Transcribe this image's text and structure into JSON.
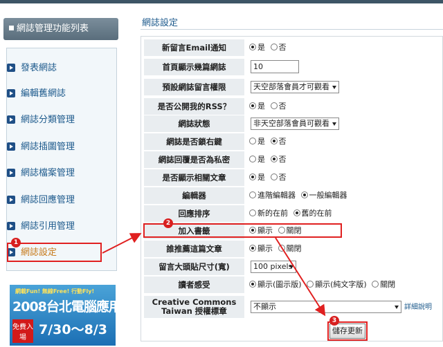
{
  "sidebar": {
    "title": "網誌管理功能列表",
    "items": [
      {
        "label": "發表網誌"
      },
      {
        "label": "編輯舊網誌"
      },
      {
        "label": "網誌分類管理"
      },
      {
        "label": "網誌插圖管理"
      },
      {
        "label": "網誌檔案管理"
      },
      {
        "label": "網誌回應管理"
      },
      {
        "label": "網誌引用管理"
      },
      {
        "label": "網誌設定"
      }
    ]
  },
  "banner": {
    "tagline": "網載Fun! 無線Free! 行動Fly!",
    "year": "2008",
    "name": "台北電腦應用展",
    "free_tag": "免費入場",
    "dates": "7/30～8/3"
  },
  "main": {
    "title": "網誌設定",
    "rows": [
      {
        "label": "新留言Email通知",
        "options": [
          "是",
          "否"
        ],
        "selected": 0
      },
      {
        "label": "首頁顯示幾篇網誌",
        "input_value": "10"
      },
      {
        "label": "預設網誌留言權限",
        "select_value": "天空部落會員才可觀看"
      },
      {
        "label": "是否公開我的RSS？",
        "options": [
          "是",
          "否"
        ],
        "selected": 0
      },
      {
        "label": "網誌狀態",
        "select_value": "非天空部落會員可觀看"
      },
      {
        "label": "網誌是否鎖右鍵",
        "options": [
          "是",
          "否"
        ],
        "selected": 1
      },
      {
        "label": "網誌回覆是否為私密",
        "options": [
          "是",
          "否"
        ],
        "selected": 1
      },
      {
        "label": "是否顯示相關文章",
        "options": [
          "是",
          "否"
        ],
        "selected": 0
      },
      {
        "label": "編輯器",
        "options": [
          "進階編輯器",
          "一般編輯器"
        ],
        "selected": 1
      },
      {
        "label": "回應排序",
        "options": [
          "新的在前",
          "舊的在前"
        ],
        "selected": 1
      },
      {
        "label": "加入書籤",
        "options": [
          "顯示",
          "關閉"
        ],
        "selected": 0
      },
      {
        "label": "誰推薦這篇文章",
        "options": [
          "顯示",
          "關閉"
        ],
        "selected": 0
      },
      {
        "label": "留言大頭貼尺寸(寬)",
        "select_value": "100 pixels"
      },
      {
        "label": "讀者感受",
        "options": [
          "顯示(圖示版)",
          "顯示(純文字版)",
          "關閉"
        ],
        "selected": 0
      },
      {
        "label": "Creative Commons",
        "label2": "Taiwan 授權標章",
        "select_value": "不顯示",
        "link": "詳細說明"
      }
    ],
    "save_label": "儲存更新"
  },
  "annotations": {
    "one": "1",
    "two": "2",
    "three": "3"
  },
  "colors": {
    "highlight": "#e02020",
    "link": "#1d5a8c",
    "label_bg": "#e9edf0"
  }
}
